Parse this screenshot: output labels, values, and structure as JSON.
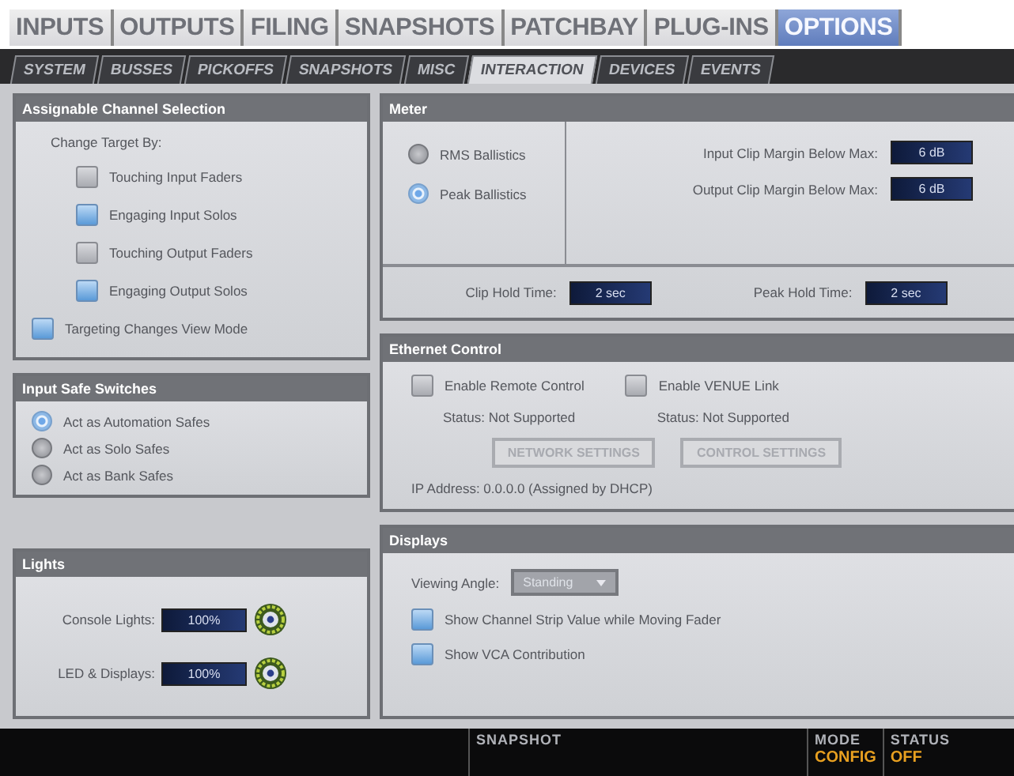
{
  "main_tabs": [
    {
      "label": "INPUTS",
      "selected": false
    },
    {
      "label": "OUTPUTS",
      "selected": false
    },
    {
      "label": "FILING",
      "selected": false
    },
    {
      "label": "SNAPSHOTS",
      "selected": false
    },
    {
      "label": "PATCHBAY",
      "selected": false
    },
    {
      "label": "PLUG-INS",
      "selected": false
    },
    {
      "label": "OPTIONS",
      "selected": true
    }
  ],
  "sub_tabs": [
    {
      "label": "SYSTEM",
      "selected": false
    },
    {
      "label": "BUSSES",
      "selected": false
    },
    {
      "label": "PICKOFFS",
      "selected": false
    },
    {
      "label": "SNAPSHOTS",
      "selected": false
    },
    {
      "label": "MISC",
      "selected": false
    },
    {
      "label": "INTERACTION",
      "selected": true
    },
    {
      "label": "DEVICES",
      "selected": false
    },
    {
      "label": "EVENTS",
      "selected": false
    }
  ],
  "assignable_channel_selection": {
    "title": "Assignable Channel Selection",
    "heading": "Change Target By:",
    "options": [
      {
        "label": "Touching Input Faders",
        "checked": false
      },
      {
        "label": "Engaging Input Solos",
        "checked": true
      },
      {
        "label": "Touching Output Faders",
        "checked": false
      },
      {
        "label": "Engaging Output Solos",
        "checked": true
      }
    ],
    "view_mode": {
      "label": "Targeting Changes View Mode",
      "checked": true
    }
  },
  "input_safe_switches": {
    "title": "Input Safe Switches",
    "options": [
      {
        "label": "Act as Automation Safes",
        "selected": true
      },
      {
        "label": "Act as Solo Safes",
        "selected": false
      },
      {
        "label": "Act as Bank Safes",
        "selected": false
      }
    ]
  },
  "lights": {
    "title": "Lights",
    "items": [
      {
        "label": "Console Lights:",
        "value": "100%"
      },
      {
        "label": "LED & Displays:",
        "value": "100%"
      }
    ]
  },
  "meter": {
    "title": "Meter",
    "ballistics": [
      {
        "label": "RMS Ballistics",
        "selected": false
      },
      {
        "label": "Peak Ballistics",
        "selected": true
      }
    ],
    "margins": [
      {
        "label": "Input Clip Margin Below Max:",
        "value": "6 dB"
      },
      {
        "label": "Output Clip Margin Below Max:",
        "value": "6 dB"
      }
    ],
    "hold_times": [
      {
        "label": "Clip Hold Time:",
        "value": "2 sec"
      },
      {
        "label": "Peak Hold Time:",
        "value": "2 sec"
      }
    ]
  },
  "ethernet_control": {
    "title": "Ethernet Control",
    "options": [
      {
        "label": "Enable Remote Control",
        "checked": false,
        "status": "Status:  Not Supported"
      },
      {
        "label": "Enable VENUE Link",
        "checked": false,
        "status": "Status:  Not Supported"
      }
    ],
    "buttons": [
      "NETWORK SETTINGS",
      "CONTROL SETTINGS"
    ],
    "ip_address": "IP Address:  0.0.0.0 (Assigned by DHCP)"
  },
  "displays": {
    "title": "Displays",
    "viewing_angle": {
      "label": "Viewing Angle:",
      "value": "Standing"
    },
    "options": [
      {
        "label": "Show Channel Strip Value while Moving Fader",
        "checked": true
      },
      {
        "label": "Show VCA Contribution",
        "checked": true
      }
    ]
  },
  "status_bar": {
    "snapshot": "SNAPSHOT",
    "mode_label": "MODE",
    "mode": "CONFIG",
    "status_label": "STATUS",
    "status": "OFF"
  }
}
